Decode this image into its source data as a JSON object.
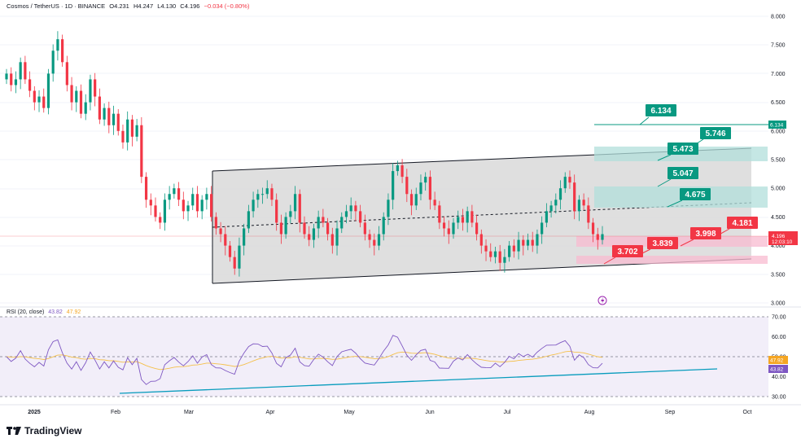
{
  "header": {
    "symbol": "Cosmos / TetherUS · 1D · BINANCE",
    "open": "O4.231",
    "high": "H4.247",
    "low": "L4.130",
    "close": "C4.196",
    "change": "−0.034 (−0.80%)"
  },
  "rsi": {
    "label": "RSI (20, close)",
    "value": "43.82",
    "ma": "47.92",
    "y_ticks": [
      "70.00",
      "60.00",
      "50.00",
      "40.00",
      "30.00"
    ],
    "badge_ma": "47.92",
    "badge_val": "43.82"
  },
  "logo": {
    "text": "TradingView"
  },
  "chart_data": {
    "type": "candlestick",
    "y_ticks": [
      "8.000",
      "7.500",
      "7.000",
      "6.500",
      "6.000",
      "5.500",
      "5.000",
      "4.500",
      "4.000",
      "3.500",
      "3.000"
    ],
    "x_ticks": [
      "2025",
      "Feb",
      "Mar",
      "Apr",
      "May",
      "Jun",
      "Jul",
      "Aug",
      "Sep",
      "Oct"
    ],
    "last_price": {
      "value": "4.196",
      "countdown": "12:03:10"
    },
    "price_badge": "6.134",
    "ylim": [
      3.0,
      8.0
    ],
    "levels": [
      "6.134",
      "5.746",
      "5.473",
      "5.047",
      "4.675",
      "4.181",
      "3.998",
      "3.839",
      "3.702"
    ],
    "candles_close_approx": [
      7.0,
      6.8,
      6.9,
      7.2,
      6.9,
      6.7,
      6.5,
      6.6,
      6.4,
      7.0,
      7.4,
      7.6,
      7.2,
      6.8,
      6.5,
      6.7,
      6.3,
      6.5,
      6.9,
      6.6,
      6.2,
      6.4,
      6.1,
      6.3,
      6.0,
      5.8,
      6.2,
      5.9,
      6.1,
      5.2,
      4.8,
      4.7,
      4.5,
      4.4,
      4.8,
      4.9,
      5.0,
      4.8,
      4.6,
      4.7,
      4.9,
      4.6,
      4.8,
      4.9,
      4.5,
      4.3,
      4.2,
      4.0,
      3.8,
      3.6,
      4.0,
      4.3,
      4.6,
      4.8,
      4.9,
      4.9,
      5.0,
      4.8,
      4.4,
      4.2,
      4.5,
      4.6,
      4.9,
      4.4,
      4.2,
      4.1,
      4.3,
      4.5,
      4.4,
      4.2,
      4.0,
      4.3,
      4.5,
      4.6,
      4.7,
      4.6,
      4.4,
      4.2,
      4.1,
      4.0,
      4.2,
      4.5,
      4.8,
      5.3,
      5.4,
      5.2,
      4.9,
      4.7,
      4.9,
      5.1,
      5.2,
      4.8,
      4.7,
      4.4,
      4.3,
      4.2,
      4.4,
      4.5,
      4.4,
      4.6,
      4.4,
      4.2,
      4.0,
      3.9,
      3.8,
      3.9,
      3.7,
      3.8,
      4.0,
      3.9,
      4.1,
      4.0,
      4.1,
      4.0,
      4.2,
      4.4,
      4.6,
      4.7,
      4.8,
      5.0,
      5.2,
      5.1,
      4.6,
      4.8,
      4.7,
      4.4,
      4.2,
      4.1,
      4.2
    ]
  }
}
